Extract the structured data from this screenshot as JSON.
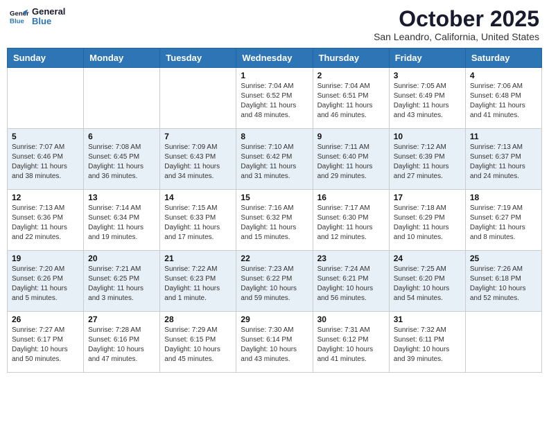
{
  "header": {
    "logo_line1": "General",
    "logo_line2": "Blue",
    "month_title": "October 2025",
    "location": "San Leandro, California, United States"
  },
  "weekdays": [
    "Sunday",
    "Monday",
    "Tuesday",
    "Wednesday",
    "Thursday",
    "Friday",
    "Saturday"
  ],
  "weeks": [
    {
      "shaded": false,
      "days": [
        {
          "num": "",
          "text": ""
        },
        {
          "num": "",
          "text": ""
        },
        {
          "num": "",
          "text": ""
        },
        {
          "num": "1",
          "text": "Sunrise: 7:04 AM\nSunset: 6:52 PM\nDaylight: 11 hours\nand 48 minutes."
        },
        {
          "num": "2",
          "text": "Sunrise: 7:04 AM\nSunset: 6:51 PM\nDaylight: 11 hours\nand 46 minutes."
        },
        {
          "num": "3",
          "text": "Sunrise: 7:05 AM\nSunset: 6:49 PM\nDaylight: 11 hours\nand 43 minutes."
        },
        {
          "num": "4",
          "text": "Sunrise: 7:06 AM\nSunset: 6:48 PM\nDaylight: 11 hours\nand 41 minutes."
        }
      ]
    },
    {
      "shaded": true,
      "days": [
        {
          "num": "5",
          "text": "Sunrise: 7:07 AM\nSunset: 6:46 PM\nDaylight: 11 hours\nand 38 minutes."
        },
        {
          "num": "6",
          "text": "Sunrise: 7:08 AM\nSunset: 6:45 PM\nDaylight: 11 hours\nand 36 minutes."
        },
        {
          "num": "7",
          "text": "Sunrise: 7:09 AM\nSunset: 6:43 PM\nDaylight: 11 hours\nand 34 minutes."
        },
        {
          "num": "8",
          "text": "Sunrise: 7:10 AM\nSunset: 6:42 PM\nDaylight: 11 hours\nand 31 minutes."
        },
        {
          "num": "9",
          "text": "Sunrise: 7:11 AM\nSunset: 6:40 PM\nDaylight: 11 hours\nand 29 minutes."
        },
        {
          "num": "10",
          "text": "Sunrise: 7:12 AM\nSunset: 6:39 PM\nDaylight: 11 hours\nand 27 minutes."
        },
        {
          "num": "11",
          "text": "Sunrise: 7:13 AM\nSunset: 6:37 PM\nDaylight: 11 hours\nand 24 minutes."
        }
      ]
    },
    {
      "shaded": false,
      "days": [
        {
          "num": "12",
          "text": "Sunrise: 7:13 AM\nSunset: 6:36 PM\nDaylight: 11 hours\nand 22 minutes."
        },
        {
          "num": "13",
          "text": "Sunrise: 7:14 AM\nSunset: 6:34 PM\nDaylight: 11 hours\nand 19 minutes."
        },
        {
          "num": "14",
          "text": "Sunrise: 7:15 AM\nSunset: 6:33 PM\nDaylight: 11 hours\nand 17 minutes."
        },
        {
          "num": "15",
          "text": "Sunrise: 7:16 AM\nSunset: 6:32 PM\nDaylight: 11 hours\nand 15 minutes."
        },
        {
          "num": "16",
          "text": "Sunrise: 7:17 AM\nSunset: 6:30 PM\nDaylight: 11 hours\nand 12 minutes."
        },
        {
          "num": "17",
          "text": "Sunrise: 7:18 AM\nSunset: 6:29 PM\nDaylight: 11 hours\nand 10 minutes."
        },
        {
          "num": "18",
          "text": "Sunrise: 7:19 AM\nSunset: 6:27 PM\nDaylight: 11 hours\nand 8 minutes."
        }
      ]
    },
    {
      "shaded": true,
      "days": [
        {
          "num": "19",
          "text": "Sunrise: 7:20 AM\nSunset: 6:26 PM\nDaylight: 11 hours\nand 5 minutes."
        },
        {
          "num": "20",
          "text": "Sunrise: 7:21 AM\nSunset: 6:25 PM\nDaylight: 11 hours\nand 3 minutes."
        },
        {
          "num": "21",
          "text": "Sunrise: 7:22 AM\nSunset: 6:23 PM\nDaylight: 11 hours\nand 1 minute."
        },
        {
          "num": "22",
          "text": "Sunrise: 7:23 AM\nSunset: 6:22 PM\nDaylight: 10 hours\nand 59 minutes."
        },
        {
          "num": "23",
          "text": "Sunrise: 7:24 AM\nSunset: 6:21 PM\nDaylight: 10 hours\nand 56 minutes."
        },
        {
          "num": "24",
          "text": "Sunrise: 7:25 AM\nSunset: 6:20 PM\nDaylight: 10 hours\nand 54 minutes."
        },
        {
          "num": "25",
          "text": "Sunrise: 7:26 AM\nSunset: 6:18 PM\nDaylight: 10 hours\nand 52 minutes."
        }
      ]
    },
    {
      "shaded": false,
      "days": [
        {
          "num": "26",
          "text": "Sunrise: 7:27 AM\nSunset: 6:17 PM\nDaylight: 10 hours\nand 50 minutes."
        },
        {
          "num": "27",
          "text": "Sunrise: 7:28 AM\nSunset: 6:16 PM\nDaylight: 10 hours\nand 47 minutes."
        },
        {
          "num": "28",
          "text": "Sunrise: 7:29 AM\nSunset: 6:15 PM\nDaylight: 10 hours\nand 45 minutes."
        },
        {
          "num": "29",
          "text": "Sunrise: 7:30 AM\nSunset: 6:14 PM\nDaylight: 10 hours\nand 43 minutes."
        },
        {
          "num": "30",
          "text": "Sunrise: 7:31 AM\nSunset: 6:12 PM\nDaylight: 10 hours\nand 41 minutes."
        },
        {
          "num": "31",
          "text": "Sunrise: 7:32 AM\nSunset: 6:11 PM\nDaylight: 10 hours\nand 39 minutes."
        },
        {
          "num": "",
          "text": ""
        }
      ]
    }
  ]
}
